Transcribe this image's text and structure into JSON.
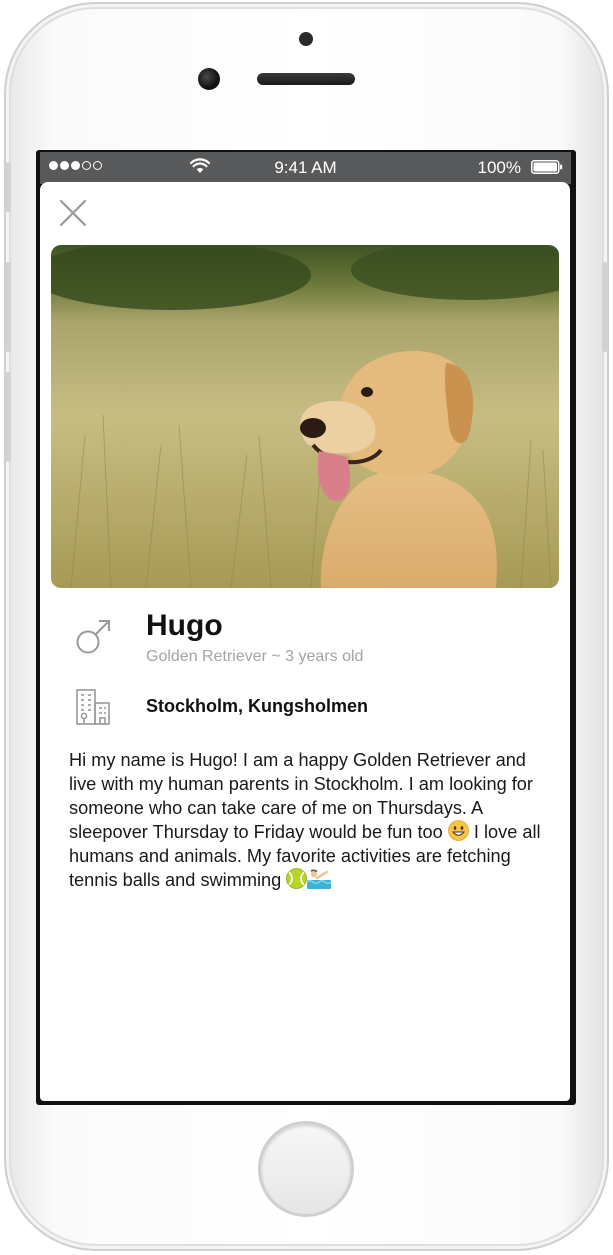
{
  "status_bar": {
    "signal_bars_filled": 3,
    "signal_bars_total": 5,
    "time": "9:41 AM",
    "battery": "100%"
  },
  "profile": {
    "name": "Hugo",
    "subtitle": "Golden Retriever ~ 3 years old",
    "location": "Stockholm, Kungsholmen",
    "bio_parts": [
      "Hi my name is Hugo! I am a happy Golden Retriever and live with my human parents in Stockholm. I am looking for someone who can take care of me on Thursdays. A sleepover Thursday to Friday would be fun too ",
      " I love all humans and animals. My favorite activities are fetching tennis balls and swimming "
    ]
  },
  "icons": {
    "close": "close-icon",
    "gender": "male-symbol-icon",
    "location": "building-icon",
    "emoji_1": "grinning-face-emoji",
    "emoji_2": "tennis-ball-emoji",
    "emoji_3": "swimmer-emoji"
  },
  "colors": {
    "status_bar_bg": "#58595b",
    "subtitle_text": "#a4a4a4",
    "icon_gray": "#9a9a9a"
  }
}
